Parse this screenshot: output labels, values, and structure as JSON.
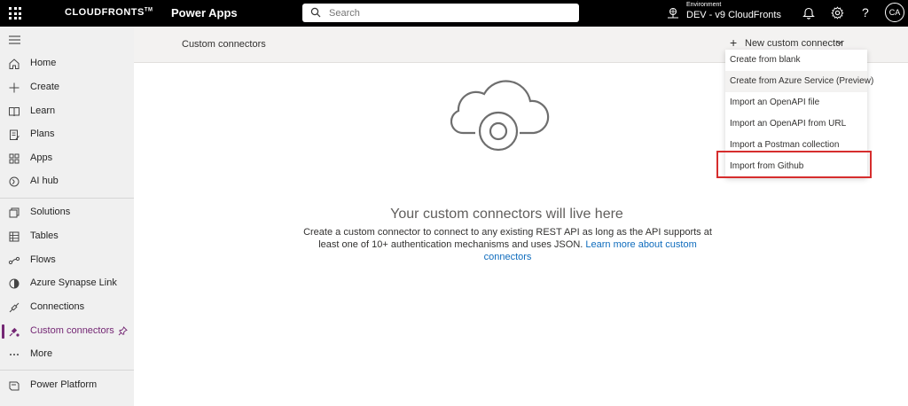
{
  "header": {
    "brand": "CLOUDFRONTS",
    "brand_tm": "TM",
    "app_name": "Power Apps",
    "search_placeholder": "Search",
    "environment_label": "Environment",
    "environment_name": "DEV - v9 CloudFronts",
    "avatar_initials": "CA"
  },
  "sidebar": {
    "items": [
      {
        "label": "Home",
        "icon": "home-icon"
      },
      {
        "label": "Create",
        "icon": "plus-icon"
      },
      {
        "label": "Learn",
        "icon": "book-icon"
      },
      {
        "label": "Plans",
        "icon": "plans-icon"
      },
      {
        "label": "Apps",
        "icon": "apps-icon"
      },
      {
        "label": "AI hub",
        "icon": "ai-hub-icon"
      },
      {
        "label": "Solutions",
        "icon": "solutions-icon"
      },
      {
        "label": "Tables",
        "icon": "table-icon"
      },
      {
        "label": "Flows",
        "icon": "flows-icon"
      },
      {
        "label": "Azure Synapse Link",
        "icon": "synapse-icon"
      },
      {
        "label": "Connections",
        "icon": "connections-icon"
      },
      {
        "label": "Custom connectors",
        "icon": "custom-connectors-icon"
      },
      {
        "label": "More",
        "icon": "more-icon"
      },
      {
        "label": "Power Platform",
        "icon": "power-platform-icon"
      }
    ],
    "active_index": 11
  },
  "command_bar": {
    "title": "Custom connectors",
    "new_button_label": "New custom connector"
  },
  "dropdown": {
    "items": [
      "Create from blank",
      "Create from Azure Service (Preview)",
      "Import an OpenAPI file",
      "Import an OpenAPI from URL",
      "Import a Postman collection",
      "Import from Github"
    ],
    "hovered_index": 1,
    "highlighted_index": 5
  },
  "empty_state": {
    "title": "Your custom connectors will live here",
    "description": "Create a custom connector to connect to any existing REST API as long as the API supports at least one of 10+ authentication mechanisms and uses JSON.",
    "link_text": "Learn more about custom connectors"
  },
  "colors": {
    "accent": "#742774",
    "link": "#0f6cbd",
    "highlight_border": "#d62d2d"
  }
}
